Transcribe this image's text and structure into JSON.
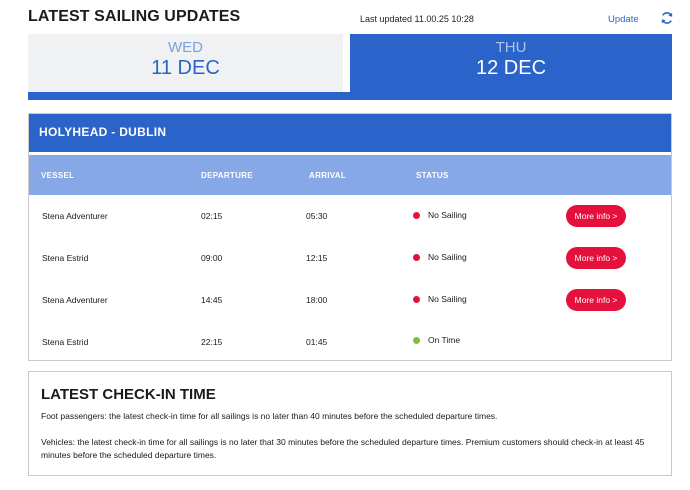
{
  "header": {
    "title": "LATEST SAILING UPDATES",
    "last_updated": "Last updated 11.00.25 10:28",
    "update_label": "Update",
    "refresh_icon": "refresh-icon"
  },
  "tabs": [
    {
      "day": "WED",
      "date": "11 DEC",
      "active": false
    },
    {
      "day": "THU",
      "date": "12 DEC",
      "active": true
    }
  ],
  "route": {
    "title": "HOLYHEAD - DUBLIN",
    "columns": [
      "VESSEL",
      "DEPARTURE",
      "ARRIVAL",
      "STATUS"
    ],
    "rows": [
      {
        "vessel": "Stena Adventurer",
        "departure": "02:15",
        "arrival": "05:30",
        "status": "No Sailing",
        "status_color": "#e5103c",
        "button": "More info >"
      },
      {
        "vessel": "Stena Estrid",
        "departure": "09:00",
        "arrival": "12:15",
        "status": "No Sailing",
        "status_color": "#e5103c",
        "button": "More info >"
      },
      {
        "vessel": "Stena Adventurer",
        "departure": "14:45",
        "arrival": "18:00",
        "status": "No Sailing",
        "status_color": "#e5103c",
        "button": "More info >"
      },
      {
        "vessel": "Stena Estrid",
        "departure": "22:15",
        "arrival": "01:45",
        "status": "On Time",
        "status_color": "#7cc043",
        "button": ""
      }
    ]
  },
  "checkin": {
    "title": "LATEST CHECK-IN TIME",
    "foot": "Foot passengers: the latest check-in time for all sailings is no later than 40 minutes before the scheduled departure times.",
    "vehicles": "Vehicles: the latest check-in time for all sailings is no later that 30 minutes before the scheduled departure times. Premium customers should check-in at least 45 minutes before the scheduled departure times."
  },
  "colors": {
    "primary_blue": "#2a63c9",
    "light_blue": "#86a8e6",
    "red": "#e5103c",
    "green": "#7cc043"
  }
}
